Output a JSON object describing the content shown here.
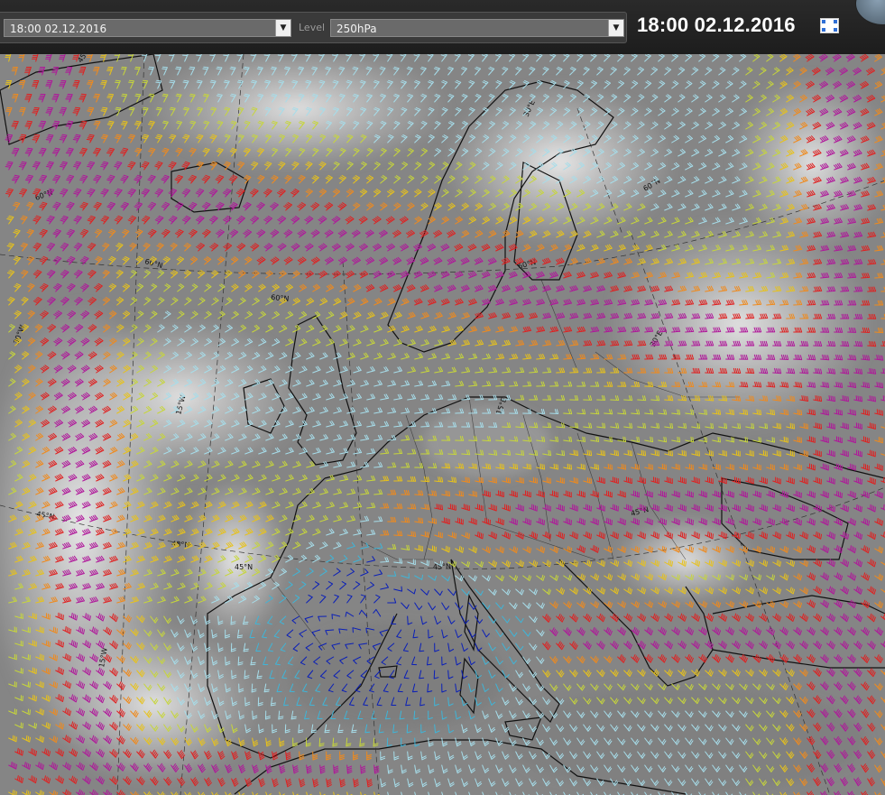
{
  "toolbar": {
    "time_value": "18:00 02.12.2016",
    "level_label": "Level",
    "level_value": "250hPa",
    "display_time": "18:00 02.12.2016"
  },
  "icons": {
    "dropdown": "chevron-down-icon",
    "fullscreen": "fullscreen-icon"
  },
  "map": {
    "graticule_labels": [
      "60°N",
      "60°N",
      "60°N",
      "60°N",
      "60°N",
      "45°N",
      "45°N",
      "45°N",
      "45°N",
      "45°N",
      "45°W",
      "30°W",
      "15°W",
      "15°W",
      "30°E",
      "30°E",
      "15°E"
    ],
    "wind_speed_colors": [
      "#0a1fb8",
      "#3fb5d8",
      "#a6ddea",
      "#c7d63a",
      "#e8c21a",
      "#f08a1c",
      "#e02020",
      "#b0169a"
    ]
  }
}
